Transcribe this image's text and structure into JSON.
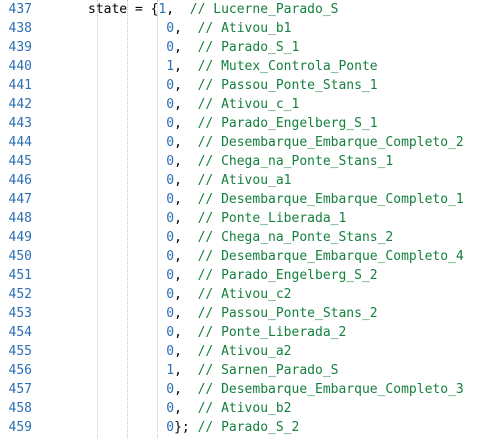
{
  "editor": {
    "statement": {
      "variable": "state",
      "assign": " = {",
      "close": "};"
    },
    "lines": [
      {
        "num": "437",
        "value": "1",
        "sep": ",",
        "comment": "// Lucerne_Parado_S"
      },
      {
        "num": "438",
        "value": "0",
        "sep": ",",
        "comment": "// Ativou_b1"
      },
      {
        "num": "439",
        "value": "0",
        "sep": ",",
        "comment": "// Parado_S_1"
      },
      {
        "num": "440",
        "value": "1",
        "sep": ",",
        "comment": "// Mutex_Controla_Ponte"
      },
      {
        "num": "441",
        "value": "0",
        "sep": ",",
        "comment": "// Passou_Ponte_Stans_1"
      },
      {
        "num": "442",
        "value": "0",
        "sep": ",",
        "comment": "// Ativou_c_1"
      },
      {
        "num": "443",
        "value": "0",
        "sep": ",",
        "comment": "// Parado_Engelberg_S_1"
      },
      {
        "num": "444",
        "value": "0",
        "sep": ",",
        "comment": "// Desembarque_Embarque_Completo_2"
      },
      {
        "num": "445",
        "value": "0",
        "sep": ",",
        "comment": "// Chega_na_Ponte_Stans_1"
      },
      {
        "num": "446",
        "value": "0",
        "sep": ",",
        "comment": "// Ativou_a1"
      },
      {
        "num": "447",
        "value": "0",
        "sep": ",",
        "comment": "// Desembarque_Embarque_Completo_1"
      },
      {
        "num": "448",
        "value": "0",
        "sep": ",",
        "comment": "// Ponte_Liberada_1"
      },
      {
        "num": "449",
        "value": "0",
        "sep": ",",
        "comment": "// Chega_na_Ponte_Stans_2"
      },
      {
        "num": "450",
        "value": "0",
        "sep": ",",
        "comment": "// Desembarque_Embarque_Completo_4"
      },
      {
        "num": "451",
        "value": "0",
        "sep": ",",
        "comment": "// Parado_Engelberg_S_2"
      },
      {
        "num": "452",
        "value": "0",
        "sep": ",",
        "comment": "// Ativou_c2"
      },
      {
        "num": "453",
        "value": "0",
        "sep": ",",
        "comment": "// Passou_Ponte_Stans_2"
      },
      {
        "num": "454",
        "value": "0",
        "sep": ",",
        "comment": "// Ponte_Liberada_2"
      },
      {
        "num": "455",
        "value": "0",
        "sep": ",",
        "comment": "// Ativou_a2"
      },
      {
        "num": "456",
        "value": "1",
        "sep": ",",
        "comment": "// Sarnen_Parado_S"
      },
      {
        "num": "457",
        "value": "0",
        "sep": ",",
        "comment": "// Desembarque_Embarque_Completo_3"
      },
      {
        "num": "458",
        "value": "0",
        "sep": ",",
        "comment": "// Ativou_b2"
      },
      {
        "num": "459",
        "value": "0",
        "sep": "};",
        "comment": "// Parado_S_2"
      }
    ],
    "colors": {
      "line_number": "#2b6fb4",
      "number_literal": "#2b6fb4",
      "comment": "#15803d",
      "text": "#000000",
      "background": "#ffffff"
    }
  }
}
